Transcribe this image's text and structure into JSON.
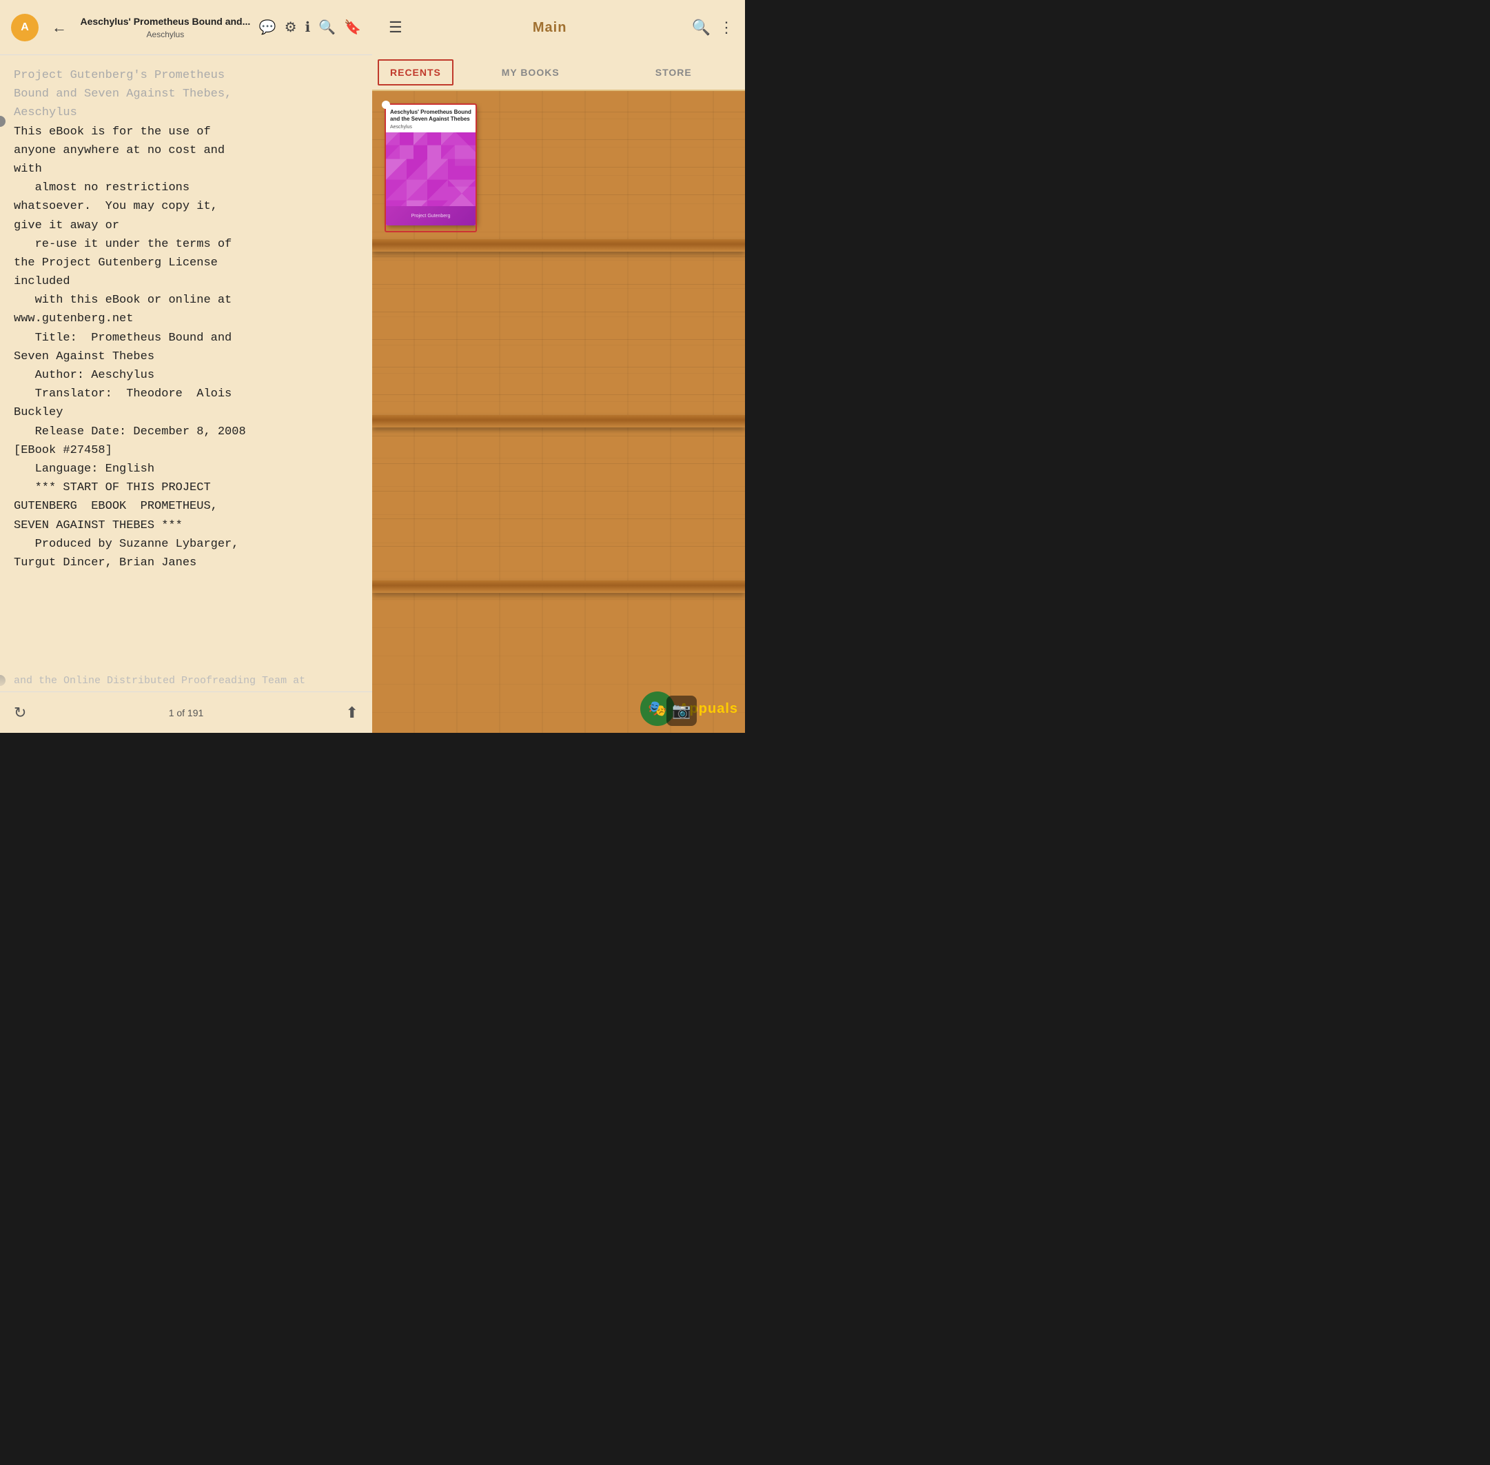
{
  "reader": {
    "back_label": "←",
    "book_title": "Aeschylus' Prometheus Bound and...",
    "book_author": "Aeschylus",
    "avatar_letter": "A",
    "bookmark_icon": "🔖",
    "speech_icon": "💬",
    "settings_icon": "⚙",
    "info_icon": "ℹ",
    "search_icon": "🔍",
    "faded_top_text": "Project Gutenberg's Prometheus\nBound and Seven Against Thebes,\nAeschylus",
    "main_text": "This eBook is for the use of\nanyone anywhere at no cost and\nwith\n   almost no restrictions\nwhatsoever.  You may copy it,\ngive it away or\n   re-use it under the terms of\nthe Project Gutenberg License\nincluded\n   with this eBook or online at\nwww.gutenberg.net\n   Title:  Prometheus Bound and\nSeven Against Thebes\n   Author: Aeschylus\n   Translator:  Theodore  Alois\nBuckley\n   Release Date: December 8, 2008\n[EBook #27458]\n   Language: English\n   *** START OF THIS PROJECT\nGUTENBERG  EBOOK  PROMETHEUS,\nSEVEN AGAINST THEBES ***\n   Produced by Suzanne Lybarger,\nTurgut Dincer, Brian Janes",
    "bottom_faded_text": "and  the  Online  Distributed\nProofreading Team at",
    "page_info": "1 of 191",
    "refresh_icon": "↻",
    "upload_icon": "⬆"
  },
  "library": {
    "hamburger_icon": "☰",
    "title": "Main",
    "search_icon": "🔍",
    "more_icon": "⋮",
    "tabs": [
      {
        "id": "recents",
        "label": "RECENTS",
        "active": true
      },
      {
        "id": "mybooks",
        "label": "MY BOOKS",
        "active": false
      },
      {
        "id": "store",
        "label": "STORE",
        "active": false
      }
    ],
    "book": {
      "title": "Aeschylus' Prometheus Bound and the\nSeven Against Thebes",
      "author": "Aeschylus",
      "bottom_text": "Project Gutenberg"
    },
    "watermark_icon": "🎭",
    "watermark_text": "A",
    "watermark_suffix": "ppuals",
    "camera_icon": "📷"
  }
}
